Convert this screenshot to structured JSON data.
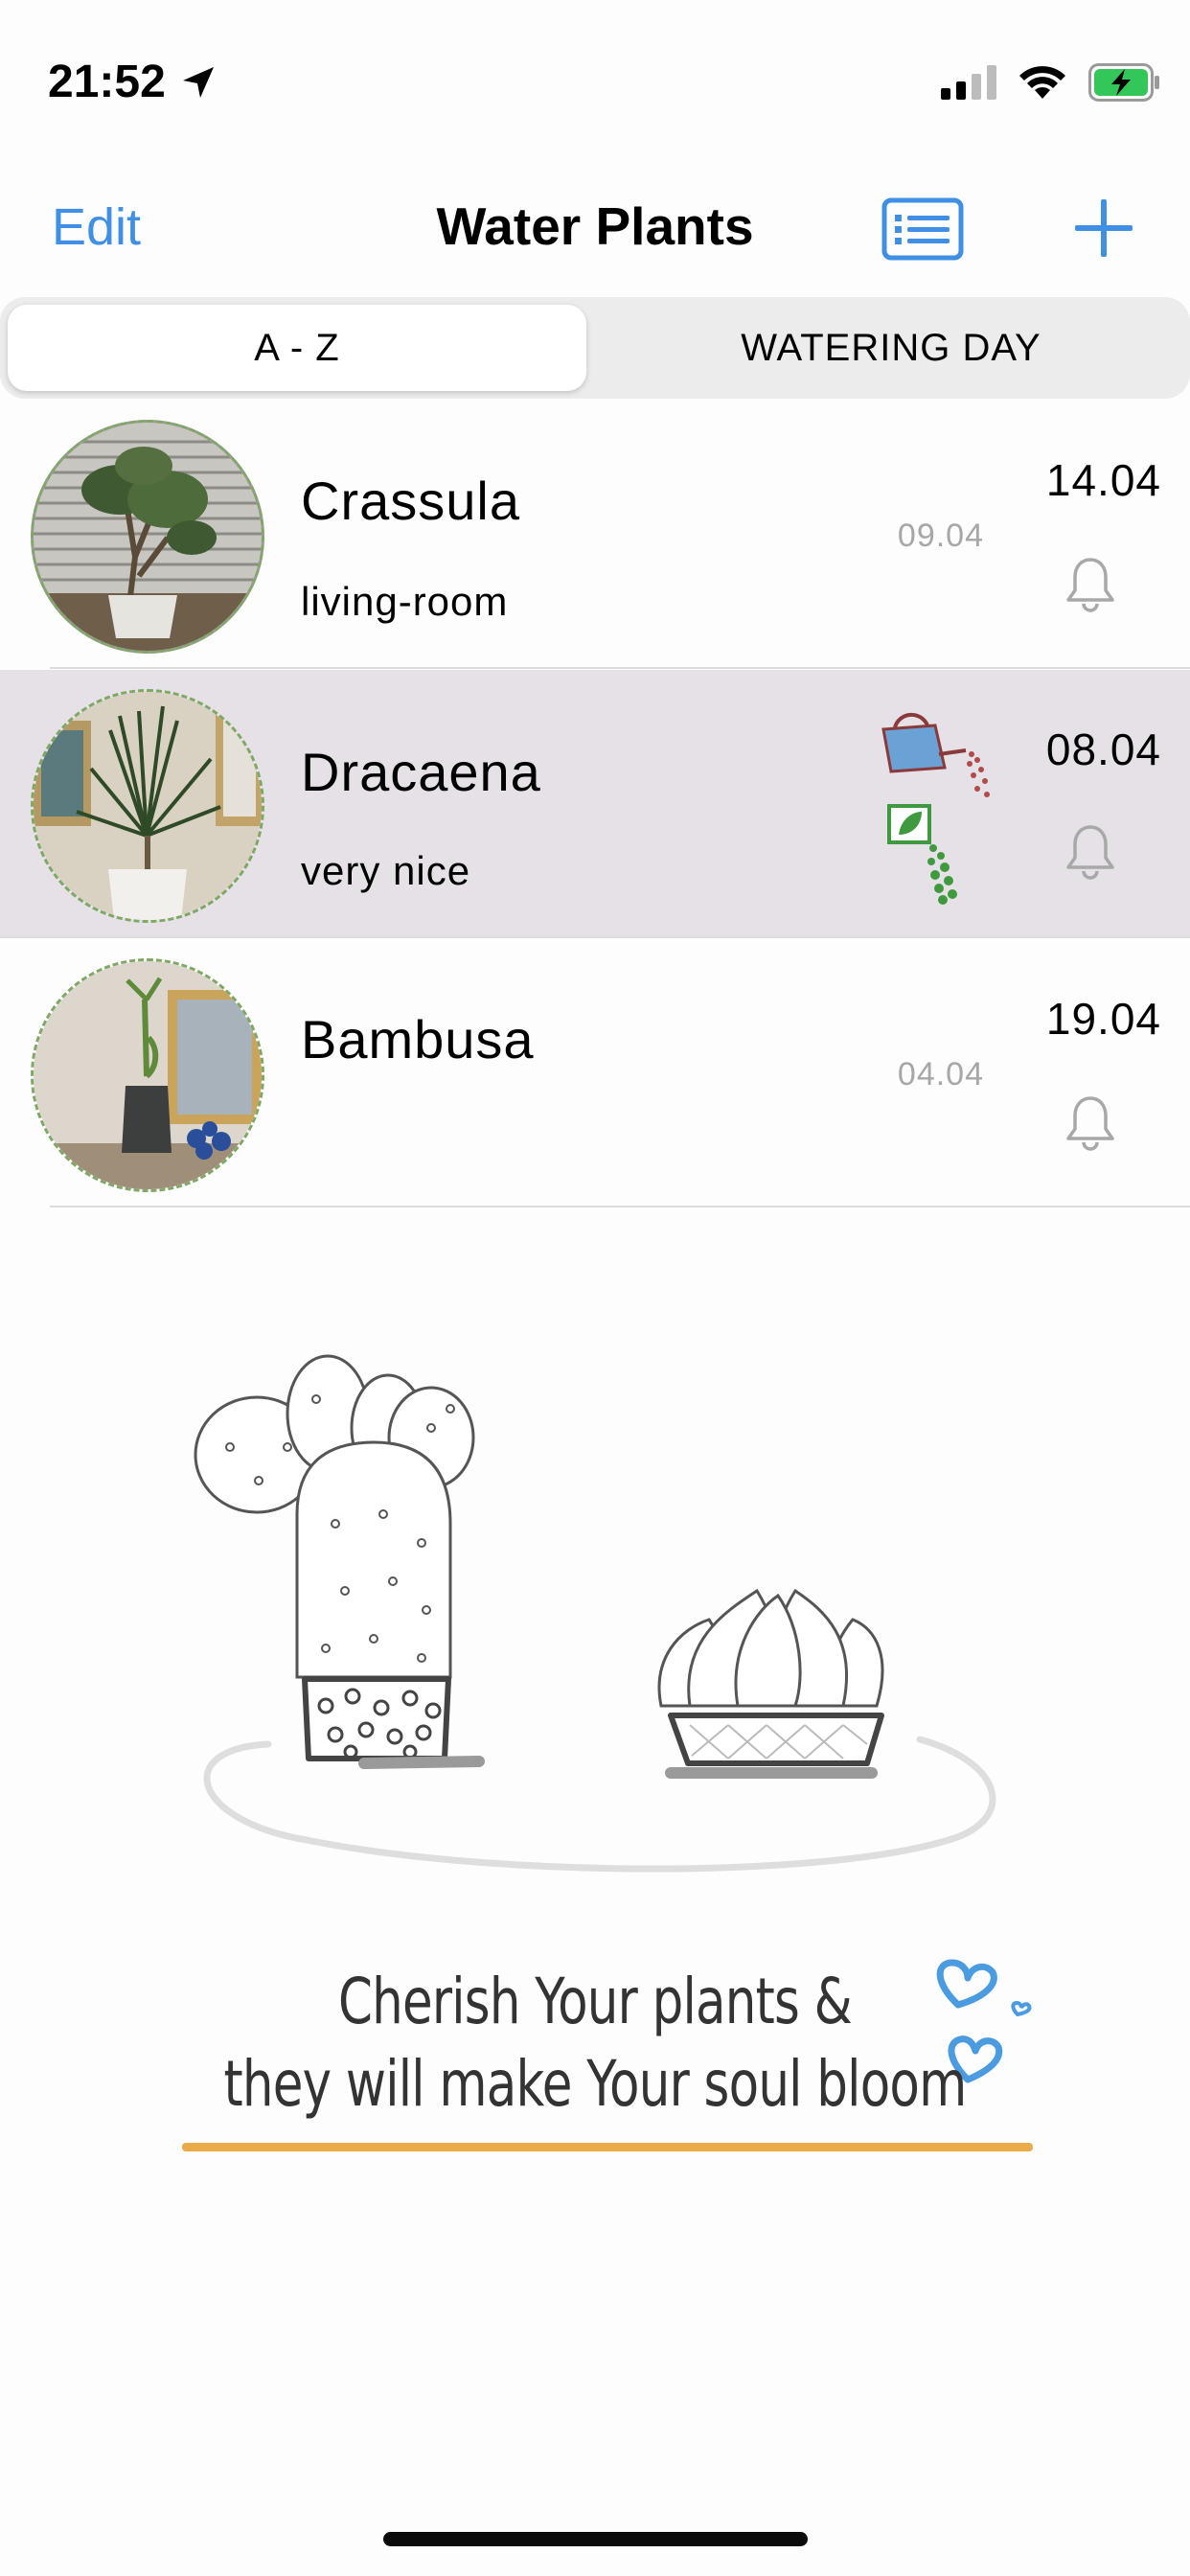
{
  "status_bar": {
    "time": "21:52",
    "icons": [
      "location-arrow-icon",
      "cellular-signal-icon",
      "wifi-icon",
      "battery-charging-icon"
    ],
    "battery_color": "#33c759"
  },
  "nav": {
    "edit_label": "Edit",
    "title": "Water Plants",
    "list_icon": "list-icon",
    "add_icon": "plus-icon",
    "accent": "#3f8fe5"
  },
  "segments": {
    "a_z": "A - Z",
    "watering_day": "WATERING DAY",
    "selected": "A - Z"
  },
  "plants": [
    {
      "name": "Crassula",
      "note": "living-room",
      "last_watered": "09.04",
      "next_watering": "14.04",
      "icon": "bell-icon"
    },
    {
      "name": "Dracaena",
      "note": "very nice",
      "last_watered": "",
      "next_watering": "08.04",
      "icon": "bell-icon",
      "status_icons": [
        "watering-can-icon",
        "fertilizer-icon"
      ],
      "selected": true
    },
    {
      "name": "Bambusa",
      "note": "",
      "last_watered": "04.04",
      "next_watering": "19.04",
      "icon": "bell-icon"
    }
  ],
  "illustration": {
    "quote_line1": "Cherish Your plants &",
    "quote_line2": "they will make Your soul bloom",
    "underline_color": "#e9ac48",
    "heart_color": "#4a9be0"
  }
}
